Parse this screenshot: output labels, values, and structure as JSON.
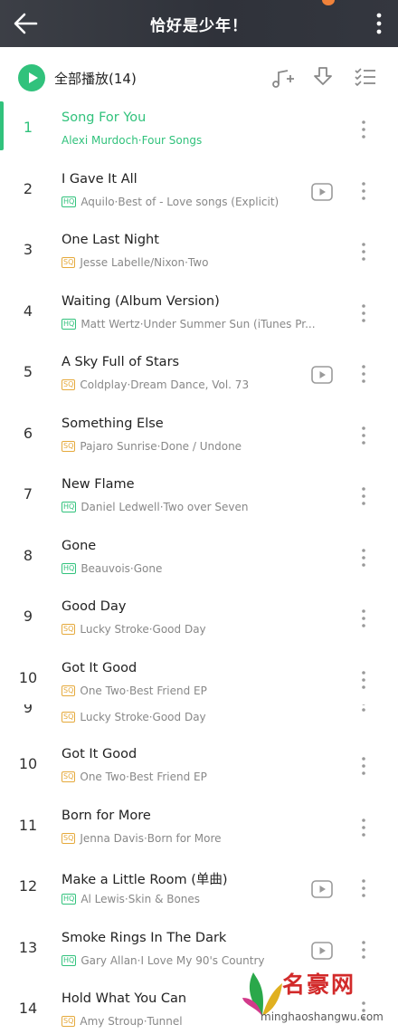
{
  "header": {
    "title": "恰好是少年！",
    "back_icon": "arrow-left-icon",
    "menu_icon": "more-vertical-icon"
  },
  "toolbar": {
    "play_all_label": "全部播放(14)",
    "icons": [
      "play-circle-icon",
      "add-to-playlist-icon",
      "download-icon",
      "multi-select-icon"
    ]
  },
  "accent_color": "#31c27c",
  "songs": [
    {
      "num": "1",
      "title": "Song For You",
      "subtitle": "Alexi Murdoch·Four Songs",
      "quality": "",
      "mv": false,
      "active": true
    },
    {
      "num": "2",
      "title": "I Gave It All",
      "subtitle": "Aquilo·Best of - Love songs (Explicit)",
      "quality": "HQ",
      "mv": true
    },
    {
      "num": "3",
      "title": "One Last Night",
      "subtitle": "Jesse Labelle/Nixon·Two",
      "quality": "SQ",
      "mv": false
    },
    {
      "num": "4",
      "title": "Waiting (Album Version)",
      "subtitle": "Matt Wertz·Under Summer Sun (iTunes Pr...",
      "quality": "HQ",
      "mv": false
    },
    {
      "num": "5",
      "title": "A Sky Full of Stars",
      "subtitle": "Coldplay·Dream Dance, Vol. 73",
      "quality": "SQ",
      "mv": true
    },
    {
      "num": "6",
      "title": "Something Else",
      "subtitle": "Pajaro Sunrise·Done / Undone",
      "quality": "SQ",
      "mv": false
    },
    {
      "num": "7",
      "title": "New Flame",
      "subtitle": "Daniel Ledwell·Two over Seven",
      "quality": "HQ",
      "mv": false
    },
    {
      "num": "8",
      "title": "Gone",
      "subtitle": "Beauvois·Gone",
      "quality": "HQ",
      "mv": false
    },
    {
      "num": "9",
      "title": "Good Day",
      "subtitle": "Lucky Stroke·Good Day",
      "quality": "SQ",
      "mv": false
    },
    {
      "num": "10",
      "title": "Got It Good",
      "subtitle": "One Two·Best Friend EP",
      "quality": "SQ",
      "mv": false
    }
  ],
  "glitch_row": {
    "num": "9",
    "subtitle": "Lucky Stroke·Good Day",
    "quality": "SQ"
  },
  "songs_after": [
    {
      "num": "10",
      "title": "Got It Good",
      "subtitle": "One Two·Best Friend EP",
      "quality": "SQ",
      "mv": false
    },
    {
      "num": "11",
      "title": "Born for More",
      "subtitle": "Jenna Davis·Born for More",
      "quality": "SQ",
      "mv": false
    },
    {
      "num": "12",
      "title": "Make a Little Room (单曲)",
      "subtitle": "Al Lewis·Skin & Bones",
      "quality": "HQ",
      "mv": true
    },
    {
      "num": "13",
      "title": "Smoke Rings In The Dark",
      "subtitle": "Gary Allan·I Love My 90's Country",
      "quality": "HQ",
      "mv": true
    },
    {
      "num": "14",
      "title": "Hold What You Can",
      "subtitle": "Amy Stroup·Tunnel",
      "quality": "SQ",
      "mv": false
    }
  ],
  "watermark": {
    "brand": "名豪网",
    "domain": "minghaoshangwu.com"
  }
}
